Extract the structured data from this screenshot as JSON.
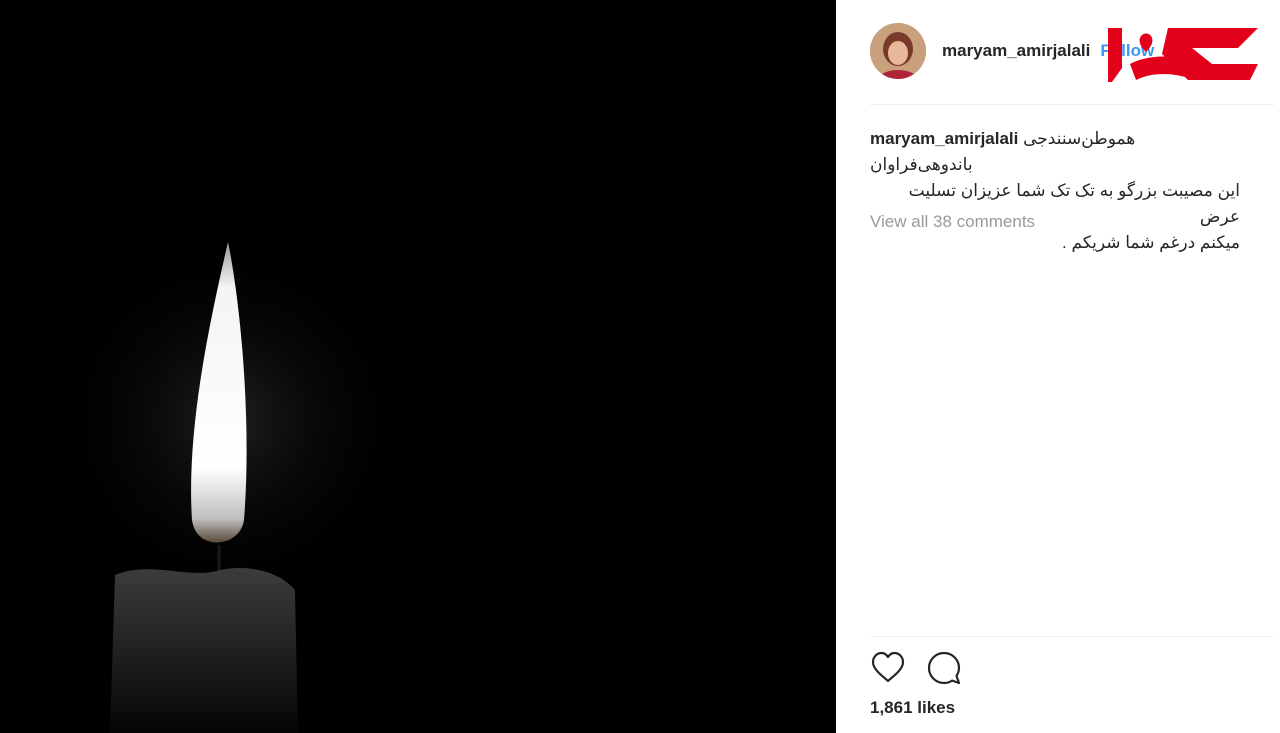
{
  "post": {
    "image_alt": "candle"
  },
  "header": {
    "username": "maryam_amirjalali",
    "follow_label": "Follow"
  },
  "watermark": {
    "icon": "rokna-logo-icon",
    "color": "#e3001b"
  },
  "caption": {
    "username": "maryam_amirjalali",
    "line1": "هموطن‌سنندجی باندوهی‌فراوان",
    "line2": "این مصیبت بزرگو به تک تک شما عزیزان تسلیت عرض",
    "line3": "میکنم درغم شما شریکم ."
  },
  "comments": {
    "view_all": "View all 38 comments"
  },
  "actions": {
    "like_icon": "heart-icon",
    "comment_icon": "comment-icon"
  },
  "likes": {
    "count_text": "1,861 likes"
  },
  "colors": {
    "link": "#3897f0",
    "muted": "#999999",
    "text": "#262626"
  }
}
